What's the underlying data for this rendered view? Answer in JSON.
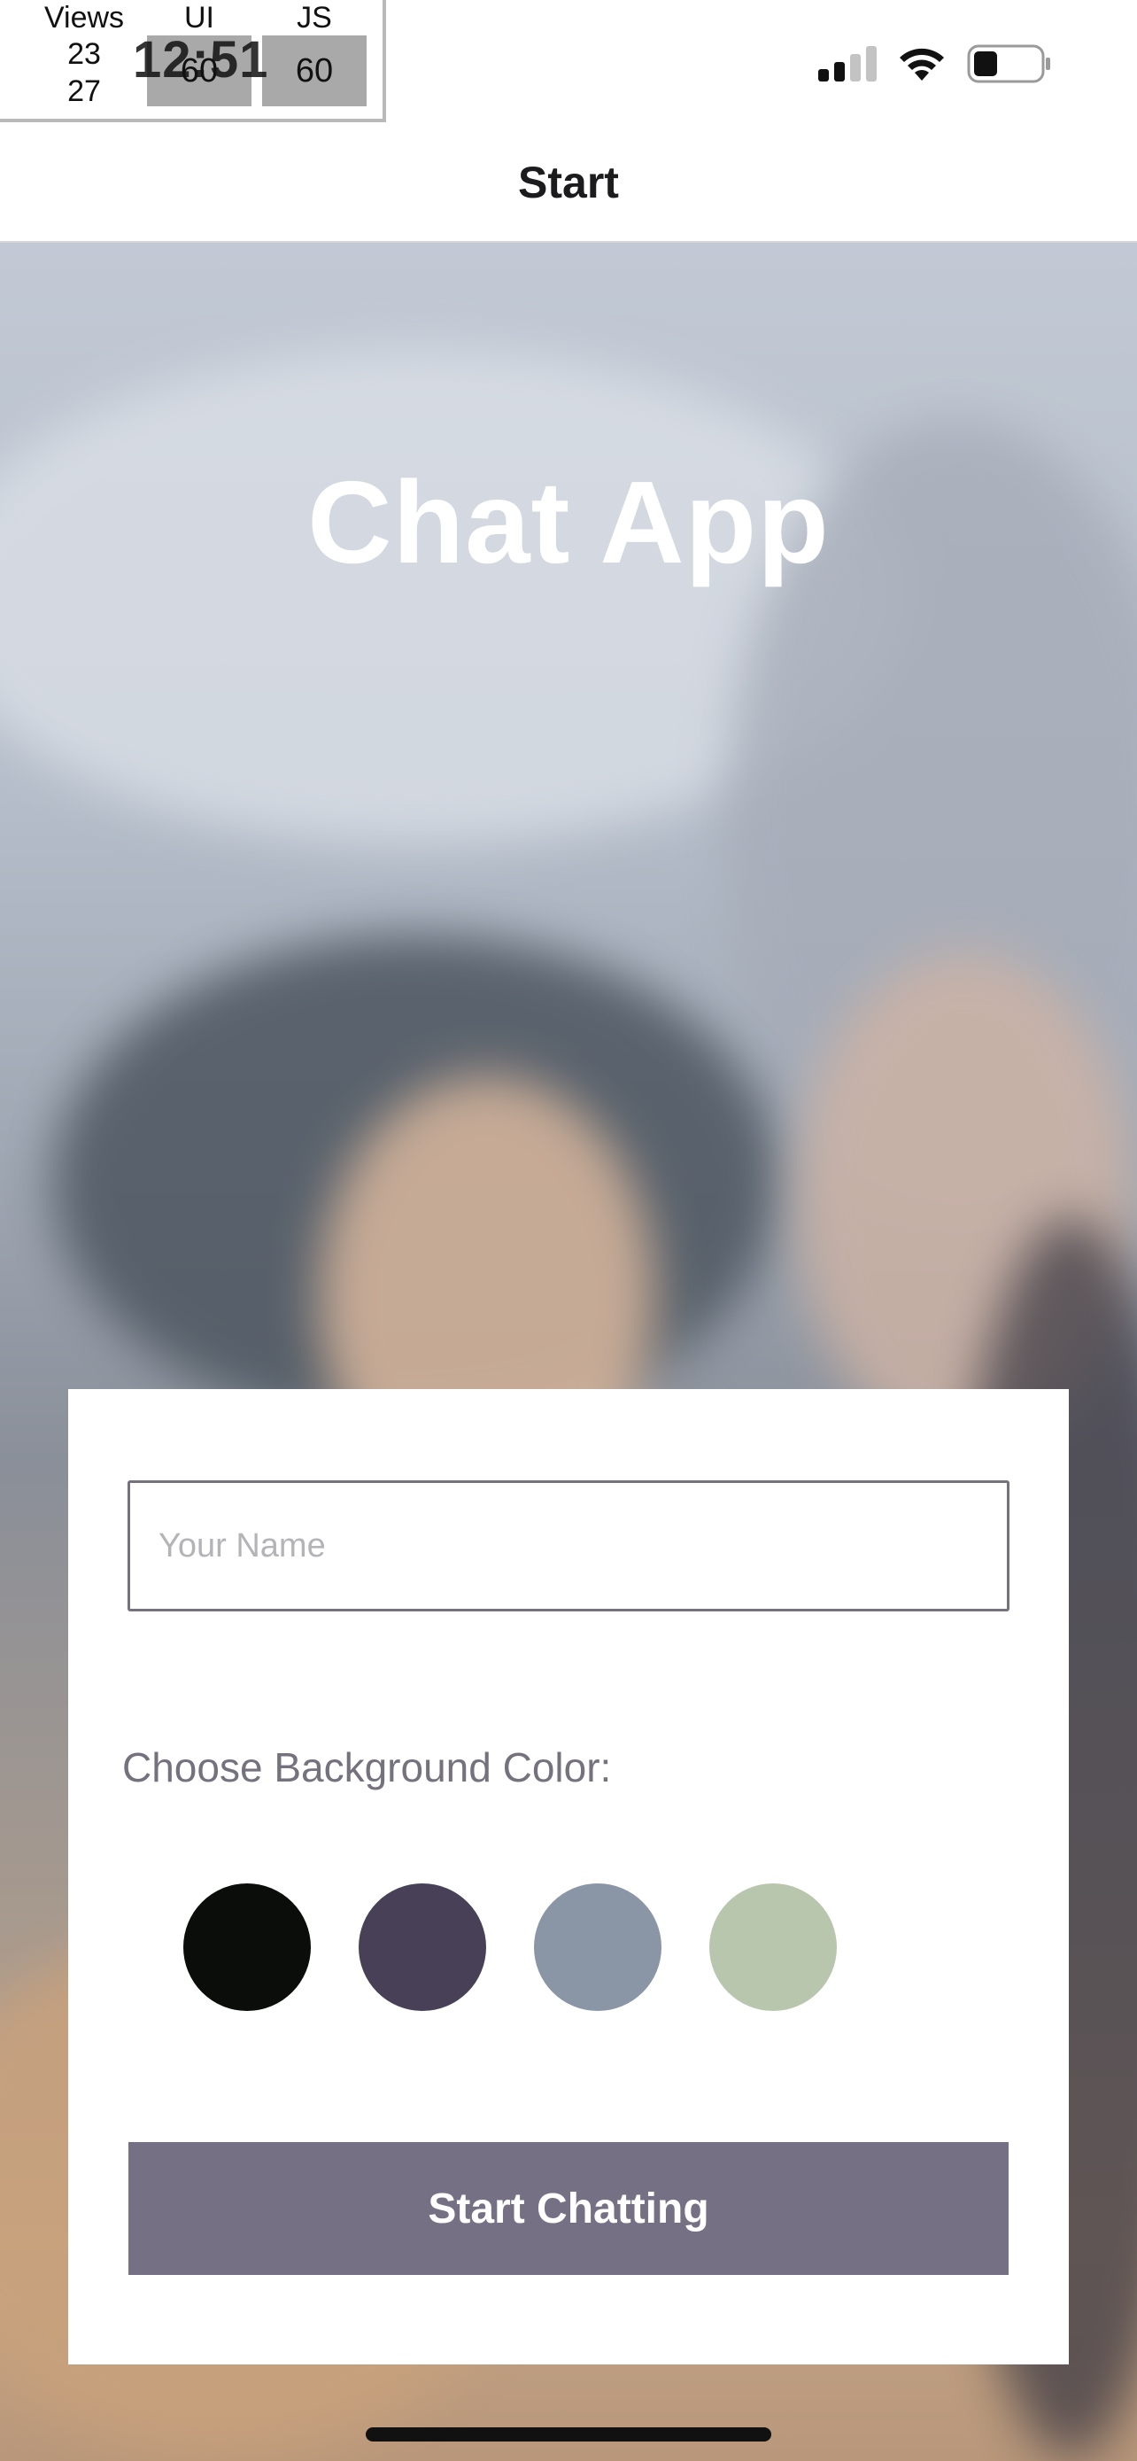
{
  "status_bar": {
    "time": "12:51",
    "perf_monitor": {
      "views_label": "Views",
      "views_values": [
        "23",
        "27"
      ],
      "ui_label": "UI",
      "ui_fps": "60",
      "js_label": "JS",
      "js_fps": "60"
    },
    "icons": [
      "cellular-signal-icon",
      "wifi-icon",
      "battery-icon"
    ]
  },
  "header": {
    "title": "Start"
  },
  "hero": {
    "title": "Chat App"
  },
  "form": {
    "name_placeholder": "Your Name",
    "name_value": "",
    "background_label": "Choose Background Color:",
    "colors": [
      "#0b0d0a",
      "#474056",
      "#8a95a5",
      "#b9c6ae"
    ],
    "button_label": "Start Chatting",
    "button_color": "#757083"
  }
}
